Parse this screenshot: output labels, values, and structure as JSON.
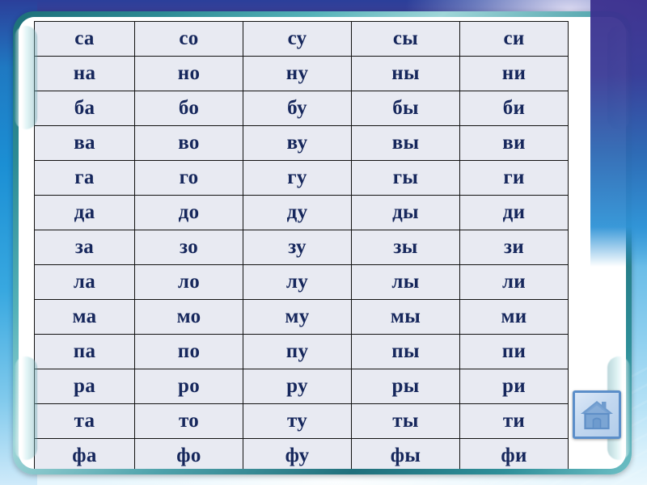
{
  "slide": {
    "theme_background_top": "#2b3f9a",
    "theme_background_bottom": "#e9f7fd",
    "frame_color": "#2d8b94",
    "panel_color": "#ffffff"
  },
  "table": {
    "name": "russian-syllable-table",
    "cell_background": "#e8eaf2",
    "text_color": "#16275c",
    "border_color": "#111111",
    "columns": 5,
    "rows": [
      [
        "са",
        "со",
        "су",
        "сы",
        "си"
      ],
      [
        "на",
        "но",
        "ну",
        "ны",
        "ни"
      ],
      [
        "ба",
        "бо",
        "бу",
        "бы",
        "би"
      ],
      [
        "ва",
        "во",
        "ву",
        "вы",
        "ви"
      ],
      [
        "га",
        "го",
        "гу",
        "гы",
        "ги"
      ],
      [
        "да",
        "до",
        "ду",
        "ды",
        "ди"
      ],
      [
        "за",
        "зо",
        "зу",
        "зы",
        "зи"
      ],
      [
        "ла",
        "ло",
        "лу",
        "лы",
        "ли"
      ],
      [
        "ма",
        "мо",
        "му",
        "мы",
        "ми"
      ],
      [
        "па",
        "по",
        "пу",
        "пы",
        "пи"
      ],
      [
        "ра",
        "ро",
        "ру",
        "ры",
        "ри"
      ],
      [
        "та",
        "то",
        "ту",
        "ты",
        "ти"
      ],
      [
        "фа",
        "фо",
        "фу",
        "фы",
        "фи"
      ]
    ]
  },
  "home_button": {
    "icon": "home-icon",
    "label": "",
    "border_color": "#5b8ec9",
    "fill_color": "#c3d8f0",
    "house_color": "#5f8fc7"
  }
}
